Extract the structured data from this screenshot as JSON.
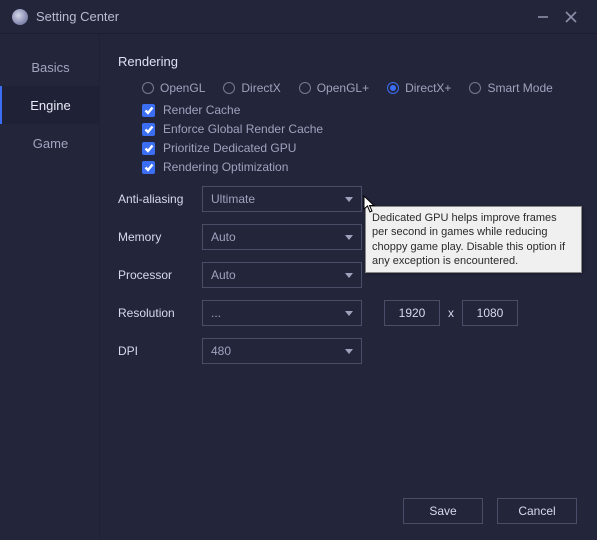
{
  "window": {
    "title": "Setting Center"
  },
  "sidebar": {
    "items": [
      {
        "label": "Basics"
      },
      {
        "label": "Engine"
      },
      {
        "label": "Game"
      }
    ],
    "active_index": 1
  },
  "section": {
    "title": "Rendering"
  },
  "render_modes": [
    {
      "label": "OpenGL",
      "selected": false
    },
    {
      "label": "DirectX",
      "selected": false
    },
    {
      "label": "OpenGL+",
      "selected": false
    },
    {
      "label": "DirectX+",
      "selected": true
    },
    {
      "label": "Smart Mode",
      "selected": false
    }
  ],
  "render_flags": [
    {
      "label": "Render Cache",
      "checked": true
    },
    {
      "label": "Enforce Global Render Cache",
      "checked": true
    },
    {
      "label": "Prioritize Dedicated GPU",
      "checked": true
    },
    {
      "label": "Rendering Optimization",
      "checked": true
    }
  ],
  "fields": {
    "antialiasing": {
      "label": "Anti-aliasing",
      "value": "Ultimate"
    },
    "memory": {
      "label": "Memory",
      "value": "Auto"
    },
    "processor": {
      "label": "Processor",
      "value": "Auto"
    },
    "resolution": {
      "label": "Resolution",
      "value": "...",
      "w": "1920",
      "sep": "X",
      "h": "1080"
    },
    "dpi": {
      "label": "DPI",
      "value": "480"
    }
  },
  "tooltip": {
    "text": "Dedicated GPU helps improve frames per second in games while reducing choppy game play. Disable this option if any exception is encountered."
  },
  "buttons": {
    "save": "Save",
    "cancel": "Cancel"
  }
}
